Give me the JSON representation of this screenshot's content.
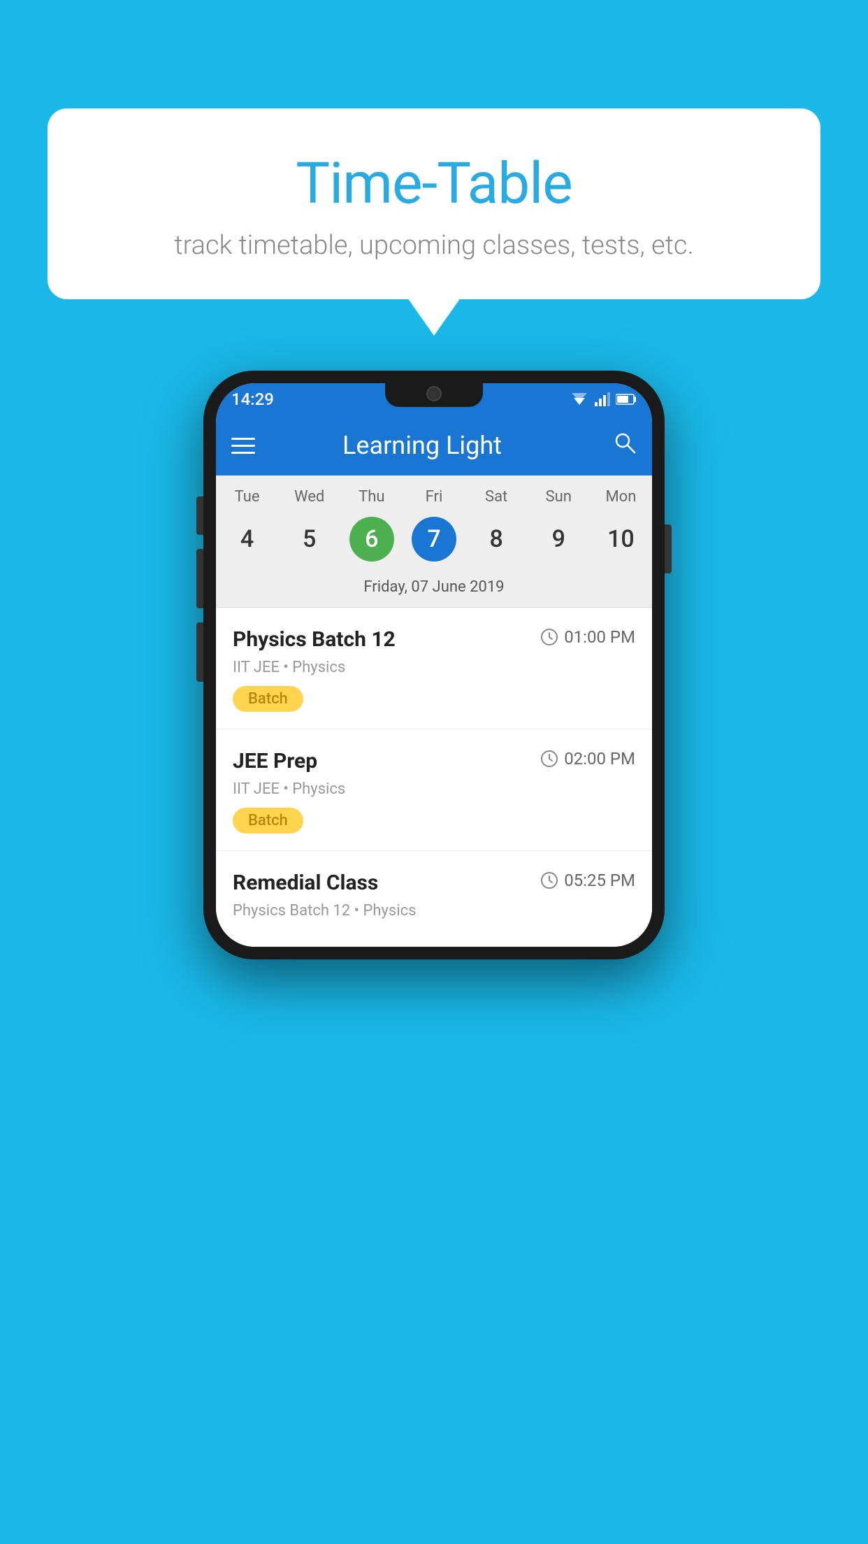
{
  "background_color": "#1ab8e8",
  "bubble": {
    "title": "Time-Table",
    "subtitle": "track timetable, upcoming classes, tests, etc."
  },
  "app": {
    "title": "Learning Light",
    "status_time": "14:29"
  },
  "calendar": {
    "days": [
      "Tue",
      "Wed",
      "Thu",
      "Fri",
      "Sat",
      "Sun",
      "Mon"
    ],
    "dates": [
      {
        "num": "4",
        "state": "normal"
      },
      {
        "num": "5",
        "state": "normal"
      },
      {
        "num": "6",
        "state": "today"
      },
      {
        "num": "7",
        "state": "selected"
      },
      {
        "num": "8",
        "state": "normal"
      },
      {
        "num": "9",
        "state": "normal"
      },
      {
        "num": "10",
        "state": "normal"
      }
    ],
    "selected_label": "Friday, 07 June 2019"
  },
  "events": [
    {
      "name": "Physics Batch 12",
      "time": "01:00 PM",
      "meta": "IIT JEE • Physics",
      "badge": "Batch"
    },
    {
      "name": "JEE Prep",
      "time": "02:00 PM",
      "meta": "IIT JEE • Physics",
      "badge": "Batch"
    },
    {
      "name": "Remedial Class",
      "time": "05:25 PM",
      "meta": "Physics Batch 12 • Physics",
      "badge": null
    }
  ]
}
